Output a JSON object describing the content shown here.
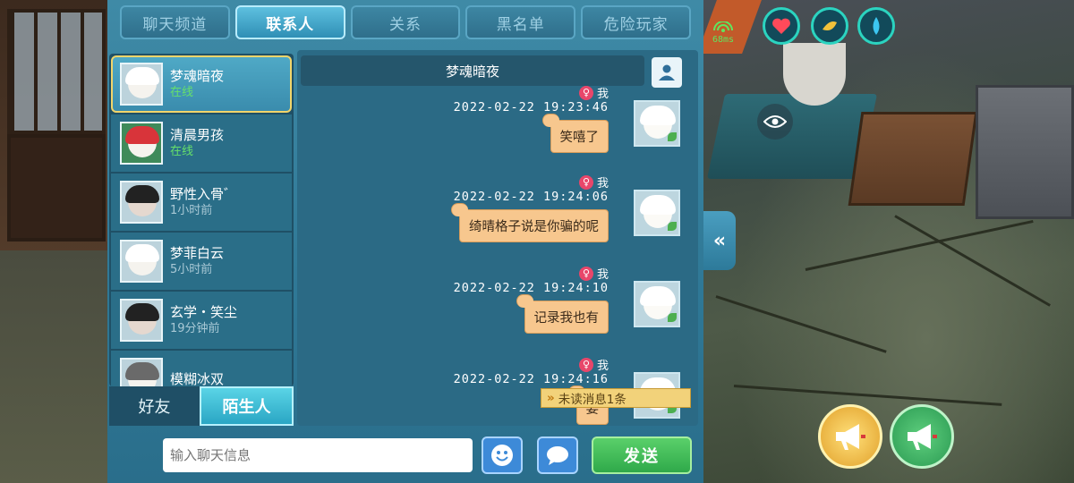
{
  "tabs": [
    {
      "label": "聊天频道"
    },
    {
      "label": "联系人"
    },
    {
      "label": "关系"
    },
    {
      "label": "黑名单"
    },
    {
      "label": "危险玩家"
    }
  ],
  "active_tab": 1,
  "contacts": [
    {
      "name": "梦魂暗夜",
      "status": "在线",
      "online": true
    },
    {
      "name": "清晨男孩",
      "status": "在线",
      "online": true
    },
    {
      "name": "野性入骨゛",
      "status": "1小时前",
      "online": false
    },
    {
      "name": "梦菲白云",
      "status": "5小时前",
      "online": false
    },
    {
      "name": "玄学・笑尘",
      "status": "19分钟前",
      "online": false
    },
    {
      "name": "模糊冰双",
      "status": "",
      "online": false
    }
  ],
  "list_tabs": {
    "friends": "好友",
    "strangers": "陌生人"
  },
  "chat": {
    "title": "梦魂暗夜",
    "messages": [
      {
        "sender": "我",
        "time": "2022-02-22  19:23:46",
        "text": "笑嘻了"
      },
      {
        "sender": "我",
        "time": "2022-02-22  19:24:06",
        "text": "绮晴格子说是你骗的呢"
      },
      {
        "sender": "我",
        "time": "2022-02-22  19:24:10",
        "text": "记录我也有"
      },
      {
        "sender": "我",
        "time": "2022-02-22  19:24:16",
        "text": "要"
      }
    ],
    "unread_notice": "未读消息1条"
  },
  "input": {
    "placeholder": "输入聊天信息",
    "send_label": "发送"
  },
  "collapse_label": "«",
  "hud": {
    "ping": "68ms"
  },
  "colors": {
    "accent": "#3f8aa6",
    "bubble": "#f7c78e",
    "send": "#2fa94a",
    "online": "#66e06a"
  }
}
